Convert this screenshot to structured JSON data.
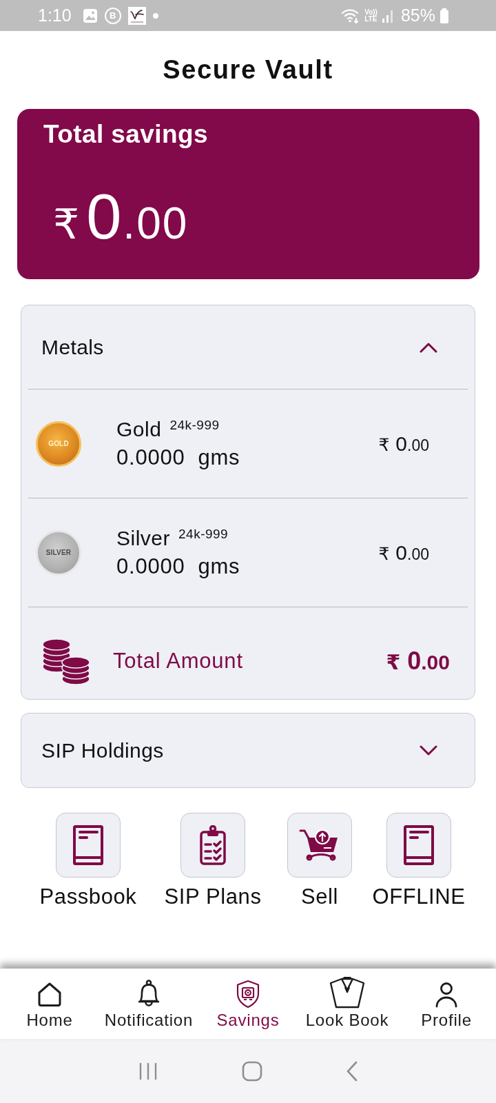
{
  "status_bar": {
    "time": "1:10",
    "notifications": [
      {
        "kind": "gallery"
      },
      {
        "kind": "chat",
        "letter": "B"
      },
      {
        "kind": "app_logo"
      },
      {
        "kind": "dot"
      }
    ],
    "volte": [
      "Vo))",
      "LTE"
    ],
    "battery": "85%"
  },
  "header": {
    "title": "Secure Vault"
  },
  "savings_card": {
    "title": "Total savings",
    "amount": {
      "currency": "₹",
      "whole": "0",
      "fraction": ".00"
    }
  },
  "sections": [
    {
      "title": "Metals",
      "expanded": true,
      "rows": [
        {
          "kind": "gold",
          "coin_label": "GOLD",
          "name": "Gold",
          "purity": "24k-999",
          "quantity": "0.0000  gms",
          "value": {
            "currency": "₹",
            "whole": "0",
            "fraction": ".00"
          }
        },
        {
          "kind": "silver",
          "coin_label": "SILVER",
          "name": "Silver",
          "purity": "24k-999",
          "quantity": "0.0000  gms",
          "value": {
            "currency": "₹",
            "whole": "0",
            "fraction": ".00"
          }
        }
      ],
      "total": {
        "label": "Total Amount",
        "value": {
          "currency": "₹",
          "whole": "0",
          "fraction": ".00"
        }
      }
    },
    {
      "title": "SIP Holdings",
      "expanded": false
    }
  ],
  "actions": [
    {
      "kind": "book",
      "label": "Passbook"
    },
    {
      "kind": "clipboard",
      "label": "SIP Plans"
    },
    {
      "kind": "cart",
      "label": "Sell"
    },
    {
      "kind": "book",
      "label": "OFFLINE"
    }
  ],
  "bottom_nav": [
    {
      "kind": "home",
      "label": "Home",
      "selected": false
    },
    {
      "kind": "bell",
      "label": "Notification",
      "selected": false
    },
    {
      "kind": "shield",
      "label": "Savings",
      "selected": true
    },
    {
      "kind": "jacket",
      "label": "Look Book",
      "selected": false
    },
    {
      "kind": "person",
      "label": "Profile",
      "selected": false
    }
  ]
}
